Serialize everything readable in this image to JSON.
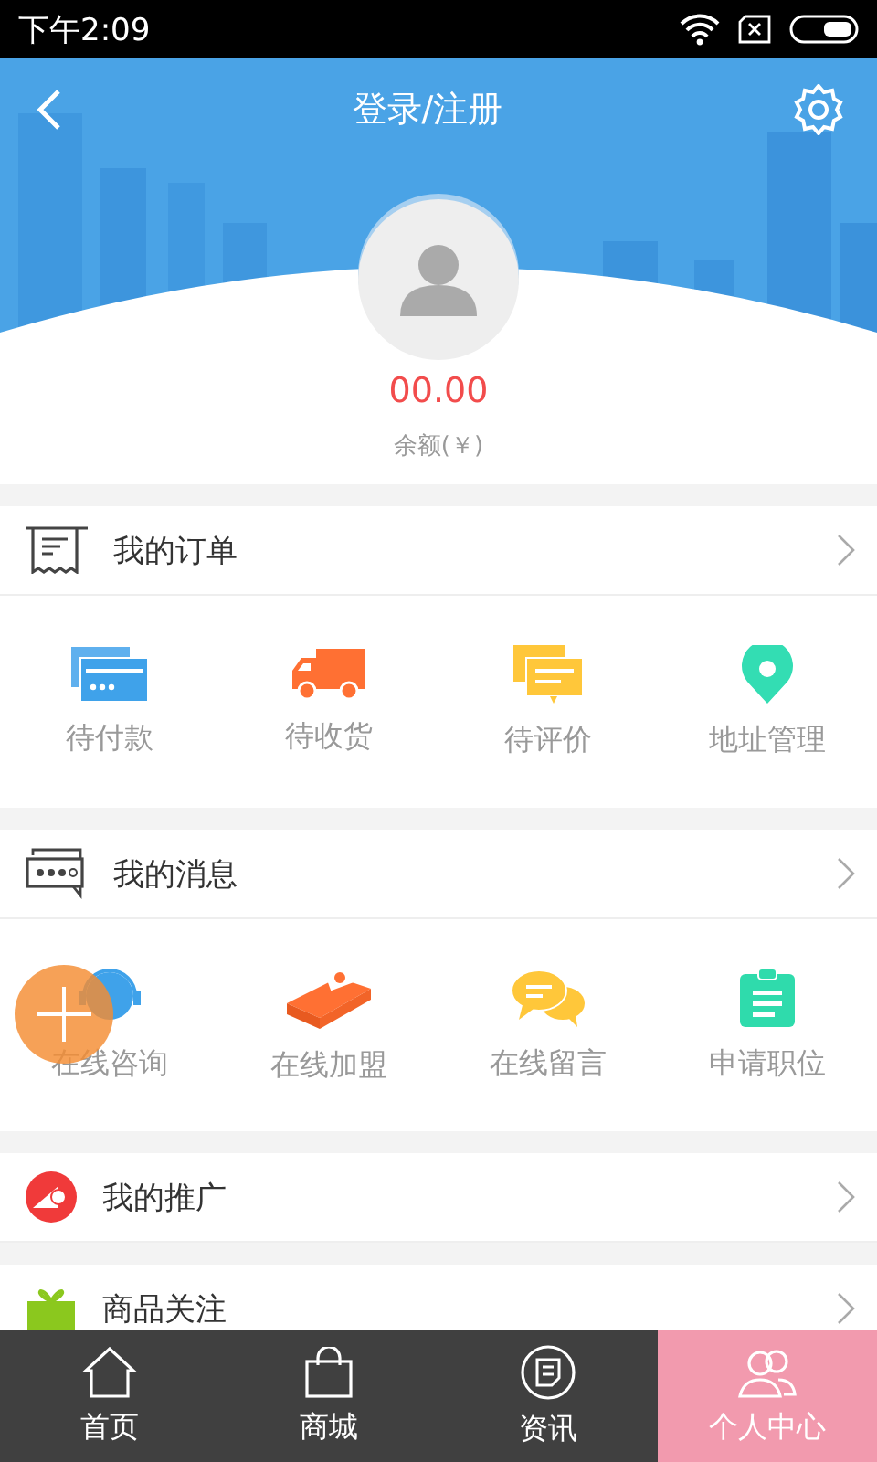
{
  "status_bar": {
    "time": "下午2:09"
  },
  "header": {
    "title": "登录/注册"
  },
  "account": {
    "balance": "00.00",
    "balance_label": "余额(￥)"
  },
  "sections": [
    {
      "kind": "orders",
      "title": "我的订单",
      "items": [
        {
          "label": "待付款"
        },
        {
          "label": "待收货"
        },
        {
          "label": "待评价"
        },
        {
          "label": "地址管理"
        }
      ]
    },
    {
      "kind": "messages",
      "title": "我的消息",
      "items": [
        {
          "label": "在线咨询"
        },
        {
          "label": "在线加盟"
        },
        {
          "label": "在线留言"
        },
        {
          "label": "申请职位"
        }
      ]
    },
    {
      "kind": "promo",
      "title": "我的推广"
    },
    {
      "kind": "gift",
      "title": "商品关注"
    }
  ],
  "tab_bar": [
    {
      "label": "首页",
      "selected": false
    },
    {
      "label": "商城",
      "selected": false
    },
    {
      "label": "资讯",
      "selected": false
    },
    {
      "label": "个人中心",
      "selected": true
    }
  ]
}
